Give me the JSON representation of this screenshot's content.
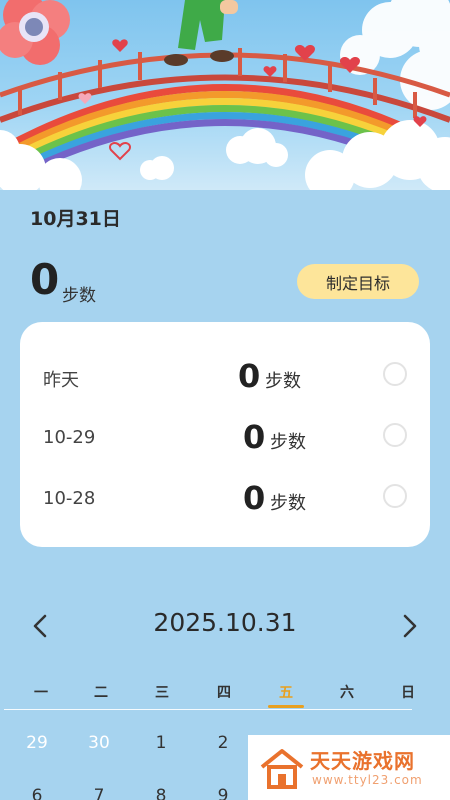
{
  "hero": {
    "description_icon": "rainbow-bridge-illustration"
  },
  "today": {
    "date": "10月31日",
    "steps": "0",
    "unit": "步数",
    "goal_button": "制定目标"
  },
  "history": [
    {
      "label": "昨天",
      "steps": "0",
      "unit": "步数"
    },
    {
      "label": "10-29",
      "steps": "0",
      "unit": "步数"
    },
    {
      "label": "10-28",
      "steps": "0",
      "unit": "步数"
    }
  ],
  "calendar": {
    "title": "2025.10.31",
    "prev_icon": "chevron-left-icon",
    "next_icon": "chevron-right-icon",
    "weekdays": [
      "一",
      "二",
      "三",
      "四",
      "五",
      "六",
      "日"
    ],
    "active_weekday_index": 4,
    "week1": [
      "29",
      "30",
      "1",
      "2"
    ],
    "week2": [
      "6",
      "7",
      "8",
      "9"
    ]
  },
  "watermark": {
    "text": "天天游戏网",
    "url": "www.ttyl23.com"
  },
  "colors": {
    "background": "#a6d3ef",
    "goal_button": "#fde59a",
    "accent": "#e8a020",
    "watermark": "#e9722d"
  }
}
